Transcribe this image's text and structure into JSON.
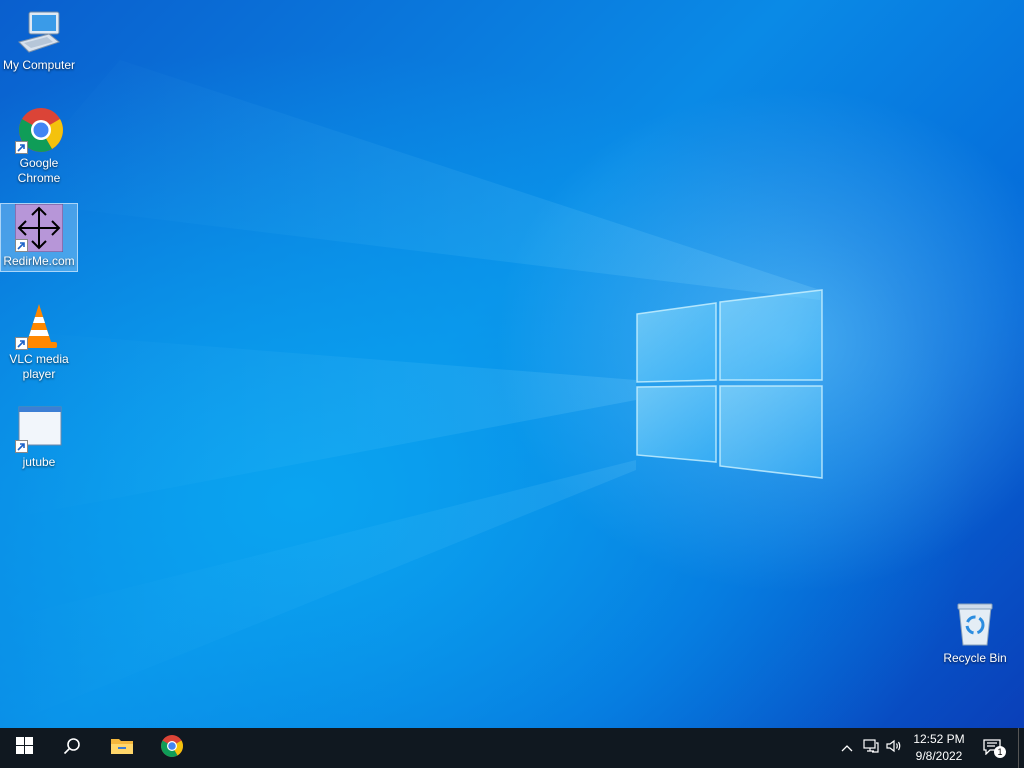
{
  "desktop_icons": [
    {
      "label": "My Computer",
      "icon": "computer-icon",
      "selected": false,
      "shortcut": false
    },
    {
      "label": "Google Chrome",
      "icon": "chrome-icon",
      "selected": false,
      "shortcut": true
    },
    {
      "label": "RedirMe.com",
      "icon": "move-arrows-icon",
      "selected": true,
      "shortcut": true
    },
    {
      "label": "VLC media player",
      "icon": "vlc-cone-icon",
      "selected": false,
      "shortcut": true
    },
    {
      "label": "jutube",
      "icon": "app-window-icon",
      "selected": false,
      "shortcut": true
    },
    {
      "label": "Recycle Bin",
      "icon": "recycle-bin-icon",
      "selected": false,
      "shortcut": false
    }
  ],
  "taskbar": {
    "start": "windows-logo-icon",
    "search": "search-icon",
    "pinned": [
      "file-explorer-icon",
      "chrome-icon"
    ],
    "tray": [
      "chevron-up-icon",
      "network-icon",
      "volume-icon"
    ],
    "time": "12:52 PM",
    "date": "9/8/2022",
    "notifications_count": "1"
  },
  "colors": {
    "wallpaper_accent": "#0a78e0",
    "taskbar": "#101820"
  }
}
